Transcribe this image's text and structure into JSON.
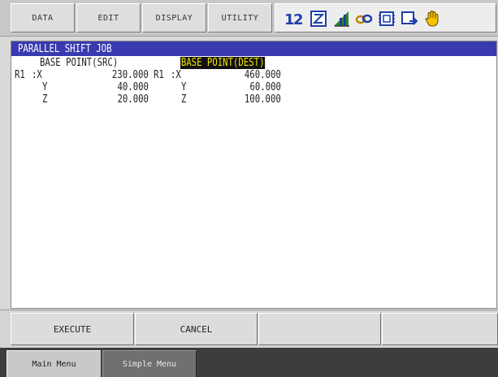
{
  "top_menu": {
    "data": "DATA",
    "edit": "EDIT",
    "display": "DISPLAY",
    "utility": "UTILITY"
  },
  "status_icons": [
    "cycle-number-icon",
    "edit-lock-icon",
    "chart-tool-icon",
    "link-icon",
    "memory-icon",
    "screen-transfer-icon",
    "hand-stop-icon"
  ],
  "window": {
    "title": "PARALLEL SHIFT JOB",
    "src_header": "BASE POINT(SRC)",
    "dest_header": "BASE POINT(DEST)",
    "src": {
      "robot": "R1",
      "x_label": ":X",
      "y_label": "Y",
      "z_label": "Z",
      "x": "230.000",
      "y": "40.000",
      "z": "20.000"
    },
    "dest": {
      "robot": "R1",
      "x_label": ":X",
      "y_label": "Y",
      "z_label": "Z",
      "x": "460.000",
      "y": "60.000",
      "z": "100.000"
    }
  },
  "function_keys": {
    "execute": "EXECUTE",
    "cancel": "CANCEL"
  },
  "bottom_menu": {
    "main": "Main Menu",
    "simple": "Simple Menu"
  },
  "colors": {
    "title_bar": "#3a3ab0",
    "highlight_bg": "#111111",
    "highlight_fg": "#f2e600",
    "bottom_bar": "#3d3d3d"
  }
}
